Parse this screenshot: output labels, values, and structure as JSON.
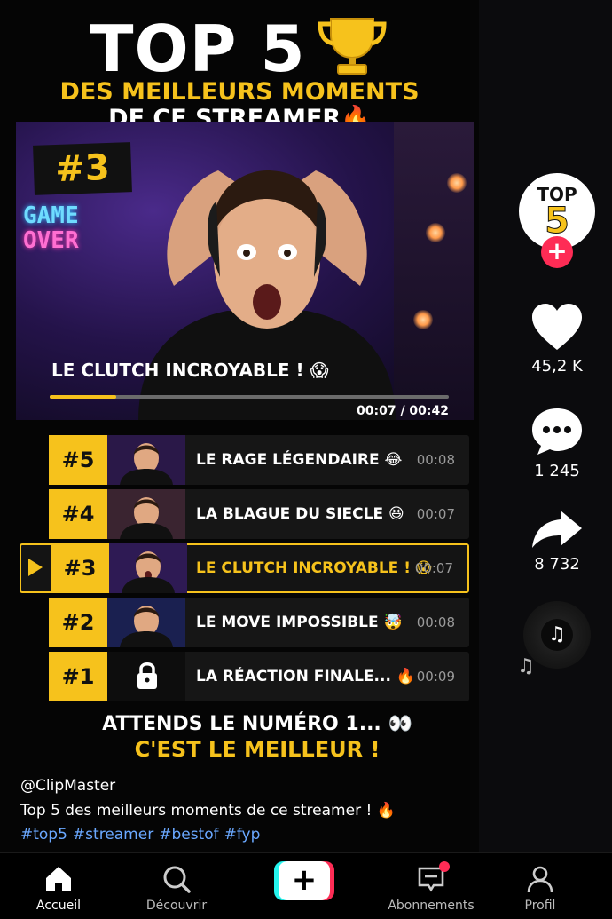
{
  "header": {
    "title": "TOP 5",
    "subtitle_line1": "DES MEILLEURS MOMENTS",
    "subtitle_line2": "DE CE STREAMER🔥"
  },
  "player": {
    "rank_badge": "#3",
    "neon_sign": [
      "GAME",
      "OVER"
    ],
    "clip_title": "LE CLUTCH INCROYABLE ! 😱",
    "current_time": "00:07",
    "duration": "00:42",
    "time_readout": "00:07 / 00:42",
    "progress": 0.167
  },
  "list": [
    {
      "rank": "#5",
      "label": "LE RAGE LÉGENDAIRE 😂",
      "duration": "00:08",
      "locked": false,
      "active": false
    },
    {
      "rank": "#4",
      "label": "LA BLAGUE DU SIECLE 😆",
      "duration": "00:07",
      "locked": false,
      "active": false
    },
    {
      "rank": "#3",
      "label": "LE CLUTCH INCROYABLE ! 😱",
      "duration": "00:07",
      "locked": false,
      "active": true
    },
    {
      "rank": "#2",
      "label": "LE MOVE IMPOSSIBLE 🤯",
      "duration": "00:08",
      "locked": false,
      "active": false
    },
    {
      "rank": "#1",
      "label": "LA RÉACTION FINALE... 🔥",
      "duration": "00:09",
      "locked": true,
      "active": false
    }
  ],
  "cta": {
    "line1": "ATTENDS LE NUMÉRO 1... 👀",
    "line2": "C'EST LE MEILLEUR !"
  },
  "post": {
    "author": "@ClipMaster",
    "caption": "Top 5 des meilleurs moments de ce streamer ! 🔥",
    "hashtags": [
      "#top5",
      "#streamer",
      "#bestof",
      "#fyp"
    ]
  },
  "sidebar": {
    "avatar_text_top": "TOP",
    "avatar_text_num": "5",
    "follow_icon": "plus-icon",
    "likes": "45,2 K",
    "comments": "1 245",
    "shares": "8 732",
    "sound_icon": "music-note-icon"
  },
  "tabbar": {
    "home": "Accueil",
    "discover": "Découvrir",
    "create_icon": "plus-icon",
    "inbox": "Abonnements",
    "profile": "Profil"
  },
  "colors": {
    "accent_yellow": "#f6c21c",
    "brand_red": "#fe2c55",
    "brand_cyan": "#25f4ee",
    "hashtag_blue": "#6aa8ff"
  }
}
